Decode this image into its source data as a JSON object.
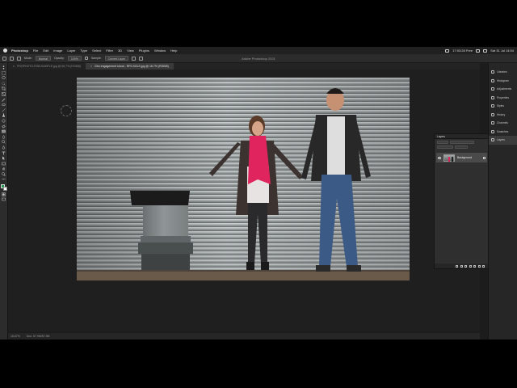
{
  "menubar": {
    "items": [
      "Photoshop",
      "File",
      "Edit",
      "Image",
      "Layer",
      "Type",
      "Select",
      "Filter",
      "3D",
      "View",
      "Plugins",
      "Window",
      "Help"
    ],
    "status_time": "Sat 31 Jul 14:54",
    "status_misc": "17:03:28 Free"
  },
  "options": {
    "mode_label": "Mode:",
    "mode_value": "Normal",
    "opacity_label": "Opacity:",
    "opacity_value": "100%",
    "sample_label": "Sample:",
    "sample_value": "Current Layer",
    "window_title": "Adobe Photoshop 2021"
  },
  "tabs": [
    {
      "label": "PROPHOTO-RGB-SAMPLE.jpg @ 66.7% (RGB/8)",
      "active": false
    },
    {
      "label": "Giro engagement shoot - RF0-SGLS.jpg @ 16.7% (RGB/8)",
      "active": true
    }
  ],
  "statusbar": {
    "zoom": "16.67%",
    "doc_info": "Doc: 57.9M/57.9M"
  },
  "dock": {
    "items": [
      "Libraries",
      "Histogram",
      "Adjustments",
      "Properties",
      "Styles",
      "History",
      "Channels",
      "Swatches",
      "Layers"
    ]
  },
  "layers_panel": {
    "title": "Layers",
    "layer_name": "Background"
  },
  "colors": {
    "foreground": "#1d9b4d",
    "background": "#ffffff",
    "scarf": "#e0245e"
  }
}
